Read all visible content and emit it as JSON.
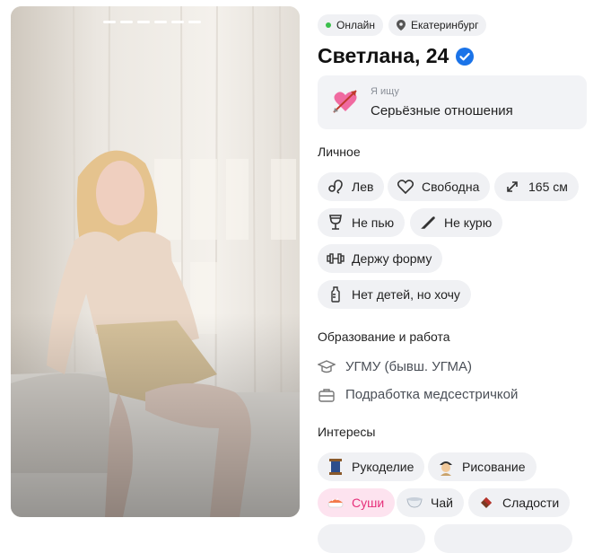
{
  "status": {
    "online": "Онлайн",
    "city": "Екатеринбург"
  },
  "profile": {
    "name_age": "Светлана, 24"
  },
  "looking_for": {
    "label": "Я ищу",
    "value": "Серьёзные отношения"
  },
  "personal": {
    "title": "Личное",
    "tags": [
      {
        "label": "Лев",
        "icon": "leo-icon"
      },
      {
        "label": "Свободна",
        "icon": "heart-icon"
      },
      {
        "label": "165 см",
        "icon": "height-icon"
      },
      {
        "label": "Не пью",
        "icon": "glass-icon"
      },
      {
        "label": "Не курю",
        "icon": "no-smoke-icon"
      },
      {
        "label": "Держу форму",
        "icon": "dumbbell-icon"
      },
      {
        "label": "Нет детей, но хочу",
        "icon": "baby-bottle-icon"
      }
    ]
  },
  "education": {
    "title": "Образование и работа",
    "items": [
      {
        "text": "УГМУ (бывш. УГМА)",
        "icon": "graduation-cap-icon"
      },
      {
        "text": "Подработка медсестричкой",
        "icon": "briefcase-icon"
      }
    ]
  },
  "interests": {
    "title": "Интересы",
    "tags": [
      {
        "label": "Рукоделие",
        "icon": "thread-spool-icon"
      },
      {
        "label": "Рисование",
        "icon": "artist-icon"
      },
      {
        "label": "Суши",
        "icon": "sushi-icon",
        "highlighted": true
      },
      {
        "label": "Чай",
        "icon": "tea-cup-icon"
      },
      {
        "label": "Сладости",
        "icon": "chocolate-icon"
      }
    ]
  },
  "colors": {
    "online": "#3bbf4c",
    "verified": "#1a73e8",
    "highlight_bg": "#fde3ef",
    "highlight_text": "#e6307a",
    "chip_bg": "#f0f1f4"
  }
}
